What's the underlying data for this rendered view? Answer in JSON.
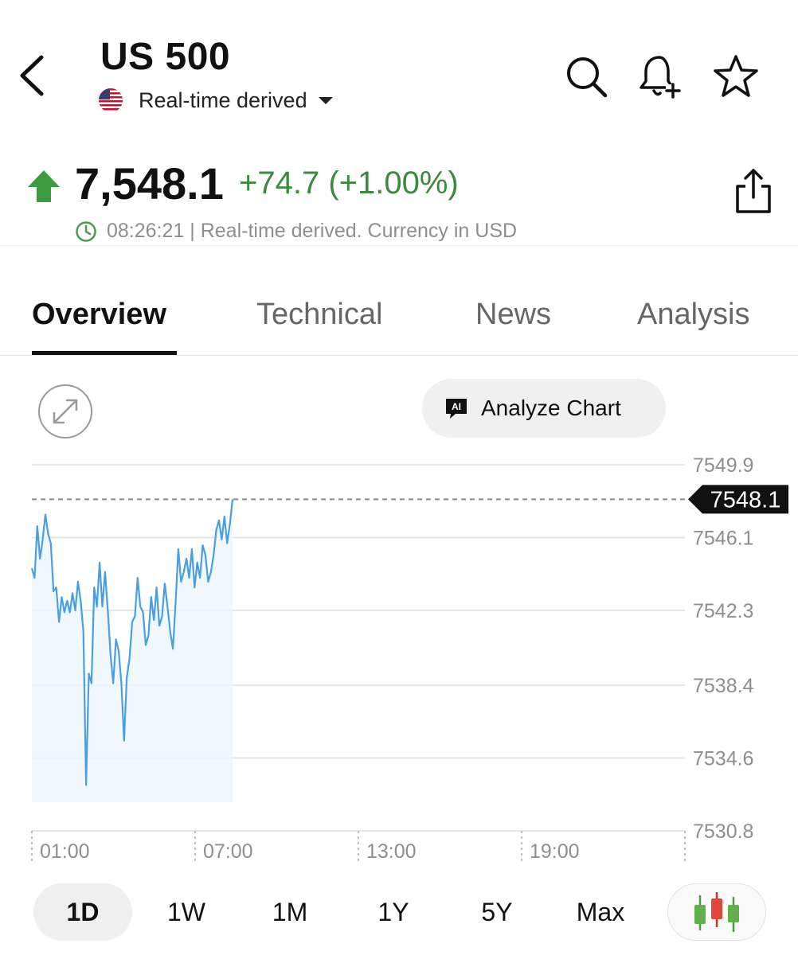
{
  "header": {
    "title": "US 500",
    "source_label": "Real-time derived"
  },
  "quote": {
    "price": "7,548.1",
    "change": "+74.7 (+1.00%)",
    "time": "08:26:21",
    "meta_text": " | Real-time derived. Currency in USD",
    "direction": "up",
    "up_color": "#3b8a3e"
  },
  "tabs": [
    {
      "label": "Overview",
      "active": true
    },
    {
      "label": "Technical",
      "active": false
    },
    {
      "label": "News",
      "active": false
    },
    {
      "label": "Analysis",
      "active": false
    }
  ],
  "chart_controls": {
    "analyze_label": "Analyze Chart",
    "ai_badge": "AI"
  },
  "range_options": [
    {
      "label": "1D",
      "active": true
    },
    {
      "label": "1W",
      "active": false
    },
    {
      "label": "1M",
      "active": false
    },
    {
      "label": "1Y",
      "active": false
    },
    {
      "label": "5Y",
      "active": false
    },
    {
      "label": "Max",
      "active": false
    }
  ],
  "icons": [
    "chevron-left-icon",
    "us-flag-icon",
    "caret-down-icon",
    "search-icon",
    "bell-plus-icon",
    "star-icon",
    "arrow-up-icon",
    "share-icon",
    "clock-icon",
    "expand-icon",
    "ai-chat-icon",
    "candlestick-icon"
  ],
  "chart_data": {
    "type": "line",
    "x_ticks": [
      "01:00",
      "07:00",
      "13:00",
      "19:00"
    ],
    "y_ticks": [
      7549.9,
      7546.1,
      7542.3,
      7538.4,
      7534.6,
      7530.8
    ],
    "ylim": [
      7530.8,
      7549.9
    ],
    "current_value": "7548.1",
    "line_color": "#4a9fe3",
    "grid": true,
    "series": [
      {
        "values": [
          7544.5,
          7544.0,
          7546.7,
          7545.0,
          7546.0,
          7547.3,
          7546.3,
          7545.8,
          7543.3,
          7543.5,
          7541.7,
          7543.0,
          7542.2,
          7542.8,
          7542.2,
          7543.2,
          7542.3,
          7543.8,
          7542.8,
          7541.2,
          7533.2,
          7539.0,
          7538.5,
          7543.5,
          7542.5,
          7544.8,
          7542.5,
          7544.3,
          7542.3,
          7540.0,
          7538.5,
          7540.8,
          7540.2,
          7538.5,
          7535.5,
          7538.8,
          7539.8,
          7541.7,
          7542.0,
          7544.0,
          7542.5,
          7542.2,
          7540.5,
          7541.0,
          7543.0,
          7541.8,
          7543.5,
          7541.5,
          7542.0,
          7543.7,
          7542.5,
          7541.2,
          7540.3,
          7542.7,
          7545.5,
          7543.8,
          7544.3,
          7545.0,
          7544.0,
          7545.5,
          7543.5,
          7544.8,
          7544.0,
          7545.7,
          7545.2,
          7543.8,
          7544.3,
          7545.2,
          7546.5,
          7547.0,
          7546.0,
          7547.2,
          7545.8,
          7546.8,
          7548.1
        ]
      }
    ]
  }
}
